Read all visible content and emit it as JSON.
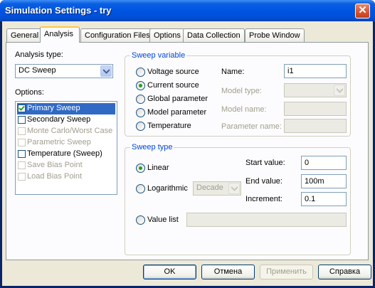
{
  "window": {
    "title": "Simulation Settings - try",
    "close_label": "✕"
  },
  "tabs": [
    {
      "label": "General"
    },
    {
      "label": "Analysis"
    },
    {
      "label": "Configuration Files"
    },
    {
      "label": "Options"
    },
    {
      "label": "Data Collection"
    },
    {
      "label": "Probe Window"
    }
  ],
  "active_tab": "Analysis",
  "analysis": {
    "analysis_type_label": "Analysis type:",
    "analysis_type_value": "DC Sweep",
    "options_label": "Options:",
    "options": [
      {
        "label": "Primary Sweep",
        "checked": true,
        "enabled": true,
        "selected": true
      },
      {
        "label": "Secondary Sweep",
        "checked": false,
        "enabled": true,
        "selected": false
      },
      {
        "label": "Monte Carlo/Worst Case",
        "checked": false,
        "enabled": false,
        "selected": false
      },
      {
        "label": "Parametric Sweep",
        "checked": false,
        "enabled": false,
        "selected": false
      },
      {
        "label": "Temperature (Sweep)",
        "checked": false,
        "enabled": true,
        "selected": false
      },
      {
        "label": "Save Bias Point",
        "checked": false,
        "enabled": false,
        "selected": false
      },
      {
        "label": "Load Bias Point",
        "checked": false,
        "enabled": false,
        "selected": false
      }
    ]
  },
  "sweep_variable": {
    "title": "Sweep variable",
    "radios": [
      {
        "label": "Voltage source",
        "checked": false
      },
      {
        "label": "Current source",
        "checked": true
      },
      {
        "label": "Global parameter",
        "checked": false
      },
      {
        "label": "Model parameter",
        "checked": false
      },
      {
        "label": "Temperature",
        "checked": false
      }
    ],
    "name_label": "Name:",
    "name_value": "i1",
    "model_type_label": "Model type:",
    "model_name_label": "Model name:",
    "parameter_name_label": "Parameter name:"
  },
  "sweep_type": {
    "title": "Sweep type",
    "linear_label": "Linear",
    "linear_checked": true,
    "log_label": "Logarithmic",
    "log_checked": false,
    "log_scale_value": "Decade",
    "start_label": "Start value:",
    "start_value": "0",
    "end_label": "End value:",
    "end_value": "100m",
    "increment_label": "Increment:",
    "increment_value": "0.1",
    "value_list_label": "Value list",
    "value_list_checked": false
  },
  "buttons": {
    "ok": "OK",
    "cancel": "Отмена",
    "apply": "Применить",
    "help": "Справка"
  },
  "colors": {
    "titlebar": "#0054e3",
    "group_title": "#0046d5",
    "selection": "#316ac5",
    "radio_dot": "#21a121"
  }
}
